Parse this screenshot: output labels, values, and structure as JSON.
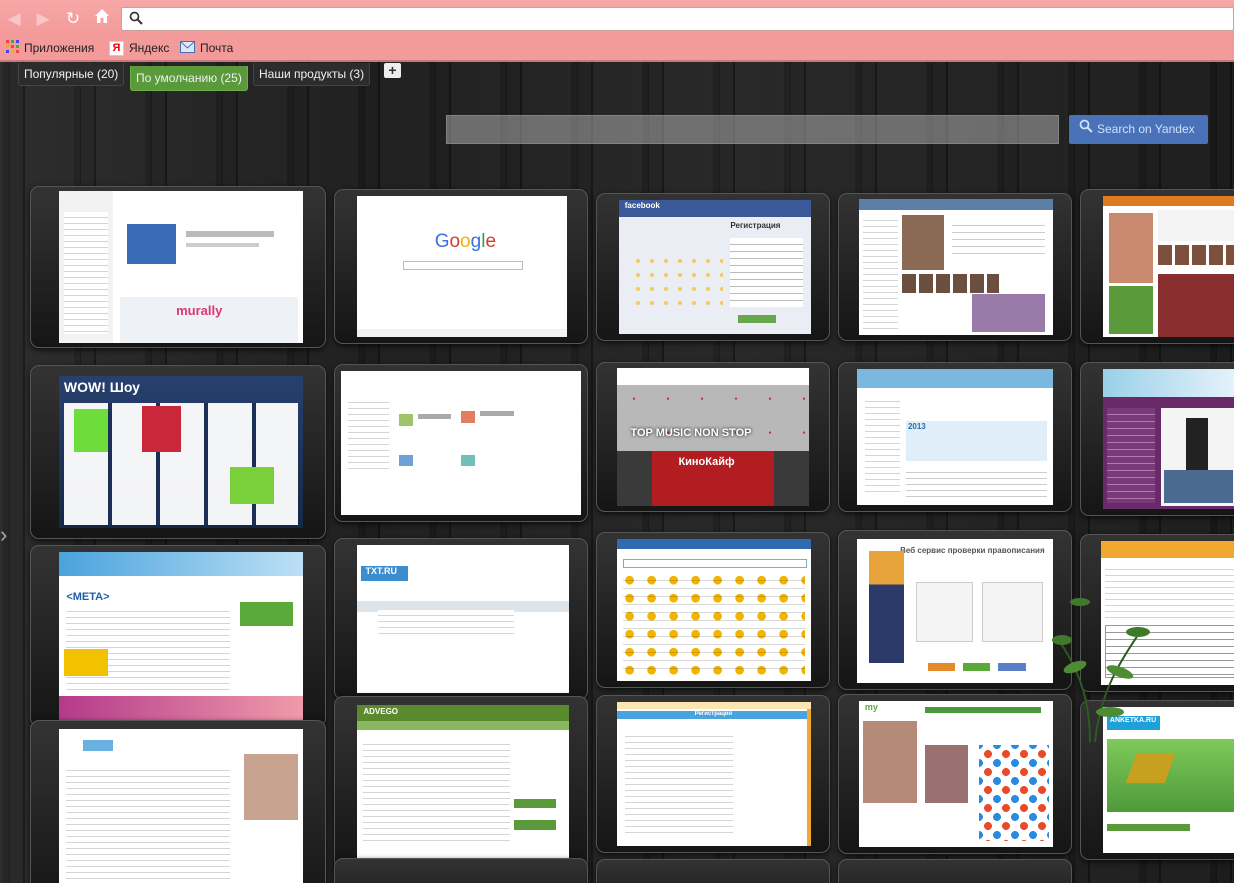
{
  "browser": {
    "address_value": "",
    "bookmarks": [
      {
        "label": "Приложения",
        "icon": "apps-grid-icon"
      },
      {
        "label": "Яндекс",
        "icon": "yandex-icon"
      },
      {
        "label": "Почта",
        "icon": "mail-icon"
      }
    ]
  },
  "tabs": [
    {
      "label": "Популярные (20)"
    },
    {
      "label": "По умолчанию (25)",
      "active": true
    },
    {
      "label": "Наши продукты (3)"
    }
  ],
  "search": {
    "placeholder": "",
    "button_label": "Search on Yandex"
  },
  "tiles": [
    {
      "id": "chrome-store",
      "logo": "murally"
    },
    {
      "id": "google",
      "logo": "Google"
    },
    {
      "id": "facebook",
      "logo": "facebook",
      "heading": "Регистрация"
    },
    {
      "id": "vk-profile",
      "logo": ""
    },
    {
      "id": "social-photos",
      "logo": ""
    },
    {
      "id": "wow-show",
      "logo": "WOW! Шоу"
    },
    {
      "id": "mail-settings",
      "logo": ""
    },
    {
      "id": "europa-plus",
      "logo": "TOP MUSIC NON STOP",
      "sub": "КиноКайф"
    },
    {
      "id": "calendar-site",
      "logo": "2013"
    },
    {
      "id": "winter-shop",
      "logo": ""
    },
    {
      "id": "meta",
      "logo": "<META>"
    },
    {
      "id": "txt-ru",
      "logo": "TXT.RU"
    },
    {
      "id": "catalog",
      "logo": ""
    },
    {
      "id": "spellcheck",
      "logo": "Веб сервис проверки правописания"
    },
    {
      "id": "news-table",
      "logo": ""
    },
    {
      "id": "journal",
      "logo": ""
    },
    {
      "id": "advego",
      "logo": "ADVEGO"
    },
    {
      "id": "registration-form",
      "logo": "Регистрация"
    },
    {
      "id": "my-profile",
      "logo": "my"
    },
    {
      "id": "anketka",
      "logo": "ANKETKA.RU"
    }
  ]
}
